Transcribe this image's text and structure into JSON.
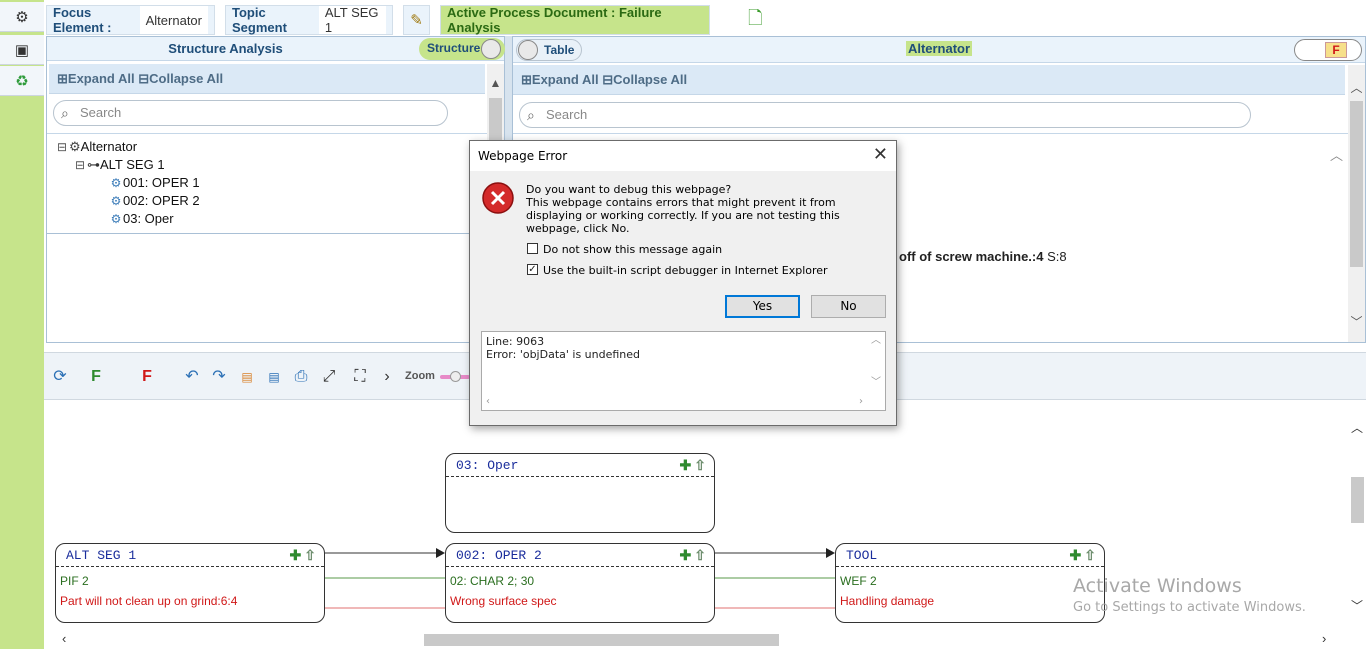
{
  "header": {
    "focus_label": "Focus Element :",
    "focus_value": "Alternator",
    "topic_label": "Topic Segment",
    "topic_value": "ALT SEG 1",
    "active_doc": "Active Process Document : Failure Analysis"
  },
  "left_panel": {
    "title": "Structure Analysis",
    "toggle_label": "Structure",
    "expand_all": "Expand All",
    "collapse_all": "Collapse All",
    "search_placeholder": "Search",
    "tree": {
      "root": "Alternator",
      "segment": "ALT SEG 1",
      "ops": [
        "001: OPER 1",
        "002: OPER 2",
        "03: Oper"
      ]
    }
  },
  "right_panel": {
    "toggle_label": "Table",
    "title": "Alternator",
    "f_button": "F",
    "expand_all": "Expand All",
    "collapse_all": "Collapse All",
    "search_placeholder": "Search",
    "partial_text_bold": "off of screw machine.:4",
    "partial_text_tail": " S:8"
  },
  "toolbar": {
    "f_green": "F",
    "f_red": "F",
    "zoom_label": "Zoom",
    "icons": [
      "refresh-icon",
      "undo-icon",
      "redo-icon",
      "svg-export-icon",
      "png-export-icon",
      "print-icon",
      "fit-icon",
      "expand-icon",
      "chevron-right-icon"
    ]
  },
  "canvas": {
    "nodes": [
      {
        "title": "03: Oper",
        "line1": "",
        "line2": ""
      },
      {
        "title": "ALT SEG 1",
        "line1": "PIF 2",
        "line2": "Part will not clean up on grind:6:4"
      },
      {
        "title": "002: OPER 2",
        "line1": "02: CHAR 2; 30",
        "line2": "Wrong surface spec"
      },
      {
        "title": "TOOL",
        "line1": "WEF 2",
        "line2": "Handling damage"
      }
    ],
    "watermark_title": "Activate Windows",
    "watermark_sub": "Go to Settings to activate Windows."
  },
  "dialog": {
    "title": "Webpage Error",
    "question": "Do you want to debug this webpage?",
    "body": "This webpage contains errors that might prevent it from displaying or working correctly. If you are not testing this webpage, click No.",
    "check1": "Do not show this message again",
    "check2": "Use the built-in script debugger in Internet Explorer",
    "yes": "Yes",
    "no": "No",
    "detail_line1": "Line: 9063",
    "detail_line2": "Error: 'objData' is undefined"
  },
  "colors": {
    "brand_green": "#c6e48b",
    "header_blue": "#1f4e79",
    "error_red": "#d01818",
    "ok_green": "#2a6e1f"
  }
}
